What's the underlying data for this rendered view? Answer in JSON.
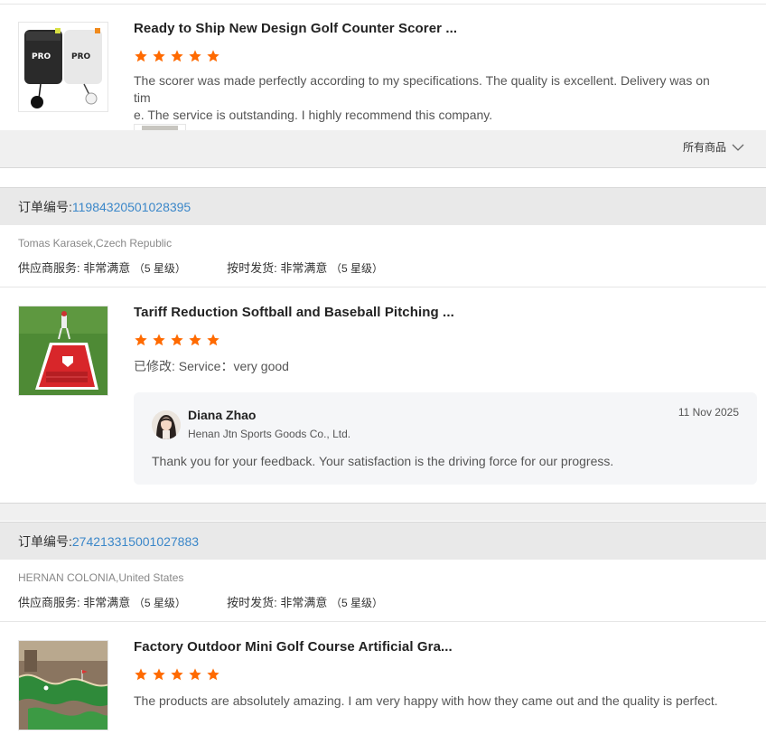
{
  "colors": {
    "star": "#ff6a00",
    "link": "#3b87c9"
  },
  "reviews": [
    {
      "product_title": "Ready to Ship New Design Golf Counter Scorer ...",
      "rating": 5,
      "text_line1": "The scorer was made perfectly according to my specifications. The quality is excellent. Delivery was on tim",
      "text_line2": "e. The service is outstanding. I highly recommend this company.",
      "image_icon": "golf-scorer-image"
    }
  ],
  "all_goods": {
    "label": "所有商品",
    "icon": "chevron-down-icon"
  },
  "orders": [
    {
      "order_label": "订单编号:",
      "order_number": "11984320501028395",
      "buyer": "Tomas Karasek,Czech Republic",
      "supplier_service_label": "供应商服务:",
      "supplier_service_value": "非常满意",
      "supplier_service_stars": "（5 星级）",
      "ontime_label": "按时发货:",
      "ontime_value": "非常满意",
      "ontime_stars": "（5 星级）",
      "product_title": "Tariff Reduction Softball and Baseball Pitching ...",
      "rating": 5,
      "review_text": "已修改: Service：very good",
      "reply": {
        "name": "Diana Zhao",
        "company": "Henan Jtn Sports Goods Co., Ltd.",
        "date": "11 Nov 2025",
        "message": "Thank you for your feedback. Your satisfaction is the driving force for our progress."
      }
    },
    {
      "order_label": "订单编号:",
      "order_number": "274213315001027883",
      "buyer": "HERNAN COLONIA,United States",
      "supplier_service_label": "供应商服务:",
      "supplier_service_value": "非常满意",
      "supplier_service_stars": "（5 星级）",
      "ontime_label": "按时发货:",
      "ontime_value": "非常满意",
      "ontime_stars": "（5 星级）",
      "product_title": "Factory Outdoor Mini Golf Course Artificial Gra...",
      "rating": 5,
      "review_text": "The products are absolutely amazing. I am very happy with how they came out and the quality is perfect."
    }
  ]
}
